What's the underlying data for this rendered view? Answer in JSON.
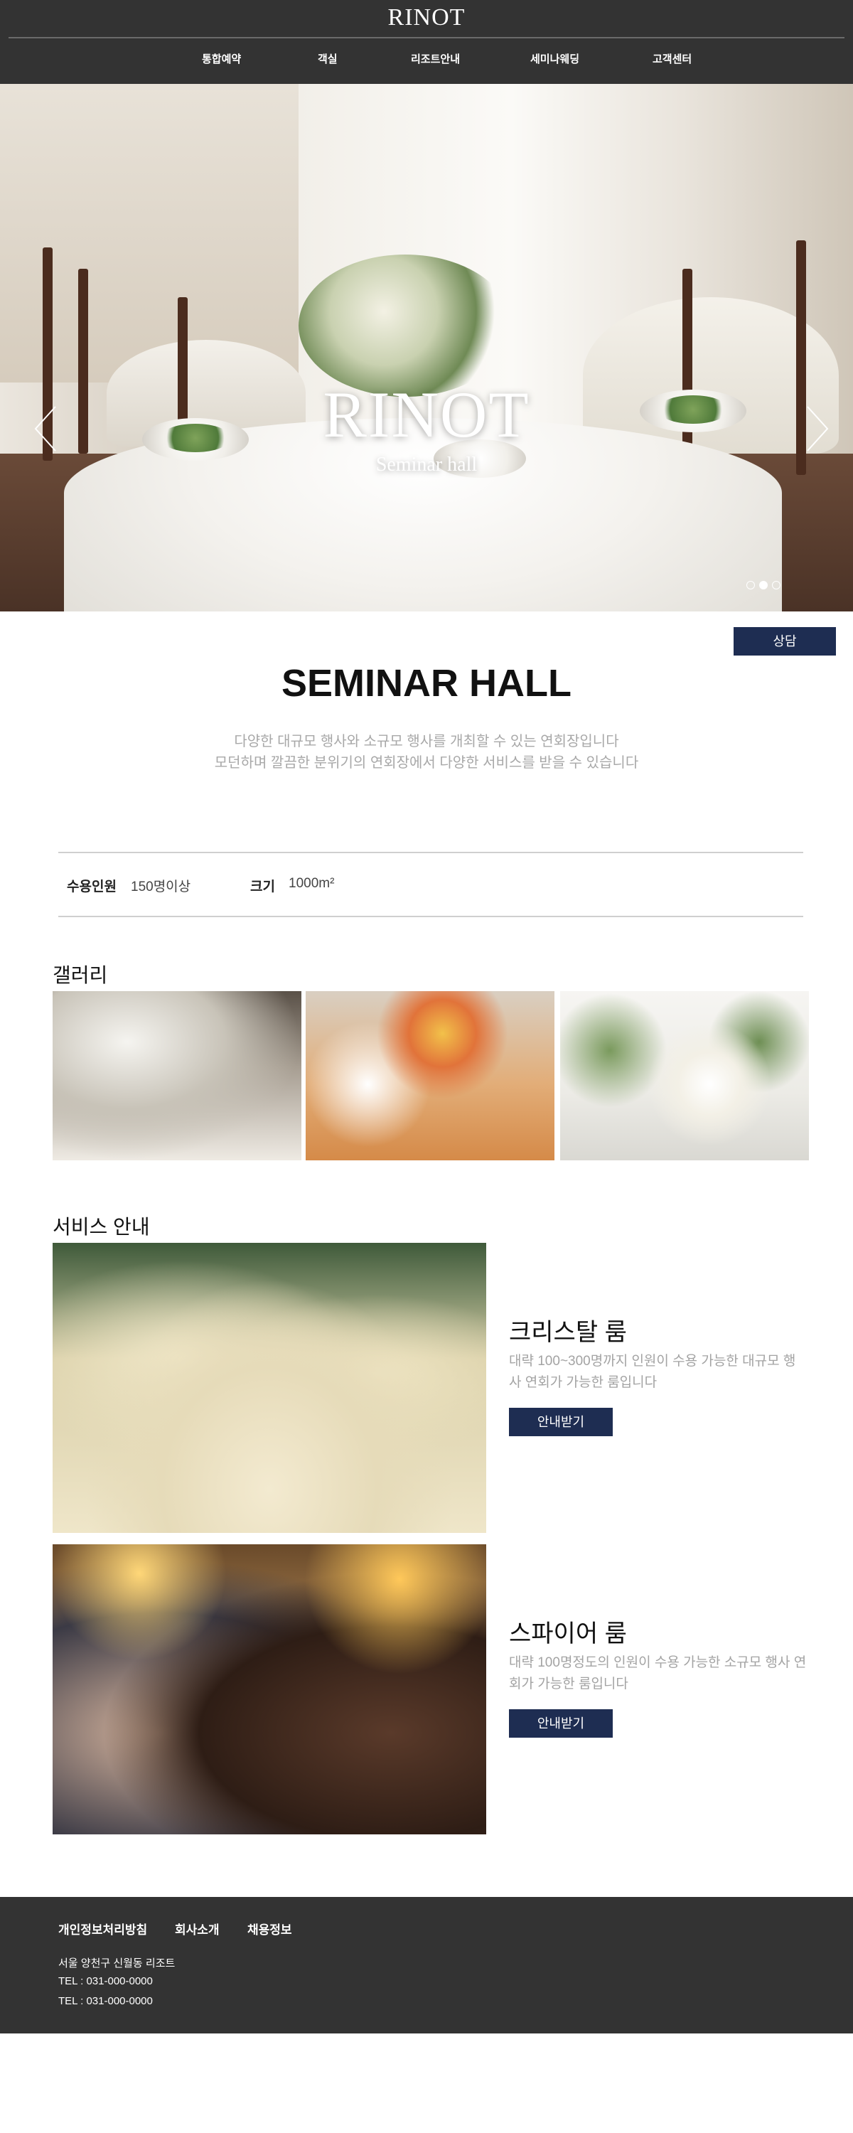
{
  "header": {
    "logo": "RINOT",
    "nav": [
      {
        "label": "통합예약"
      },
      {
        "label": "객실"
      },
      {
        "label": "리조트안내"
      },
      {
        "label": "세미나웨딩"
      },
      {
        "label": "고객센터"
      }
    ]
  },
  "hero": {
    "title": "RINOT",
    "subtitle": "Seminar hall",
    "slide_count": 3,
    "active_slide": 2
  },
  "consult_button": "상담",
  "intro": {
    "title": "SEMINAR HALL",
    "desc_line1": "다양한 대규모 행사와 소규모 행사를 개최할 수 있는 연회장입니다",
    "desc_line2": "모던하며 깔끔한 분위기의 연회장에서 다양한 서비스를 받을 수 있습니다"
  },
  "info": {
    "capacity_label": "수용인원",
    "capacity_value": "150명이상",
    "size_label": "크기",
    "size_value": "1000m²"
  },
  "gallery": {
    "title": "갤러리"
  },
  "services": {
    "title": "서비스 안내",
    "items": [
      {
        "name": "크리스탈 룸",
        "desc": "대략 100~300명까지 인원이 수용 가능한 대규모 행사 연회가 가능한 룸입니다",
        "button": "안내받기"
      },
      {
        "name": "스파이어 룸",
        "desc": "대략 100명정도의 인원이 수용 가능한 소규모 행사 연회가 가능한 룸입니다",
        "button": "안내받기"
      }
    ]
  },
  "footer": {
    "links": [
      {
        "label": "개인정보처리방침"
      },
      {
        "label": "회사소개"
      },
      {
        "label": "채용정보"
      }
    ],
    "address": "서울 양천구 신월동 리조트",
    "tel1": "TEL : 031-000-0000",
    "tel2": "TEL : 031-000-0000"
  },
  "colors": {
    "header_bg": "#333333",
    "accent_button": "#1e2d52",
    "desc_text": "#a8a8a8"
  }
}
